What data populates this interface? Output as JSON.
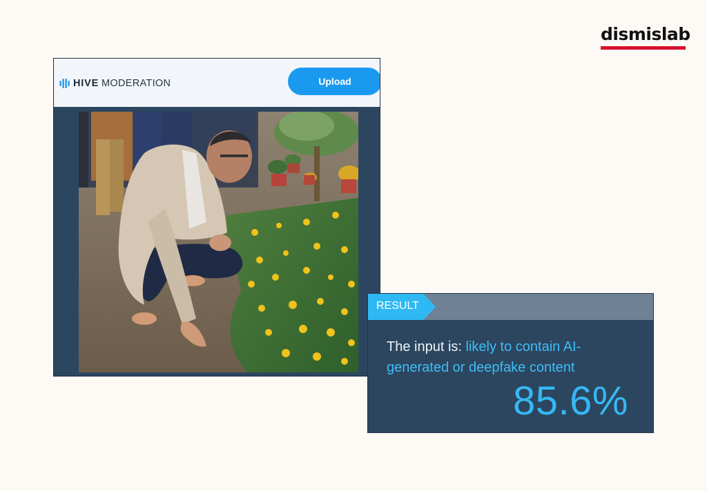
{
  "brand": {
    "logo_text": "dismislab",
    "logo_underline_color": "#d8102b"
  },
  "hive": {
    "brand_bold": "HIVE",
    "brand_light": "MODERATION",
    "brand_icon": "hive-bars-icon",
    "upload_label": "Upload",
    "accent_color": "#1a9aef",
    "image_icon": "analyzed-photo"
  },
  "result": {
    "tag": "RESULT",
    "prefix": "The input is: ",
    "verdict": "likely to contain AI-generated or deepfake content",
    "percent": "85.6%",
    "accent_color": "#36b8f4"
  }
}
